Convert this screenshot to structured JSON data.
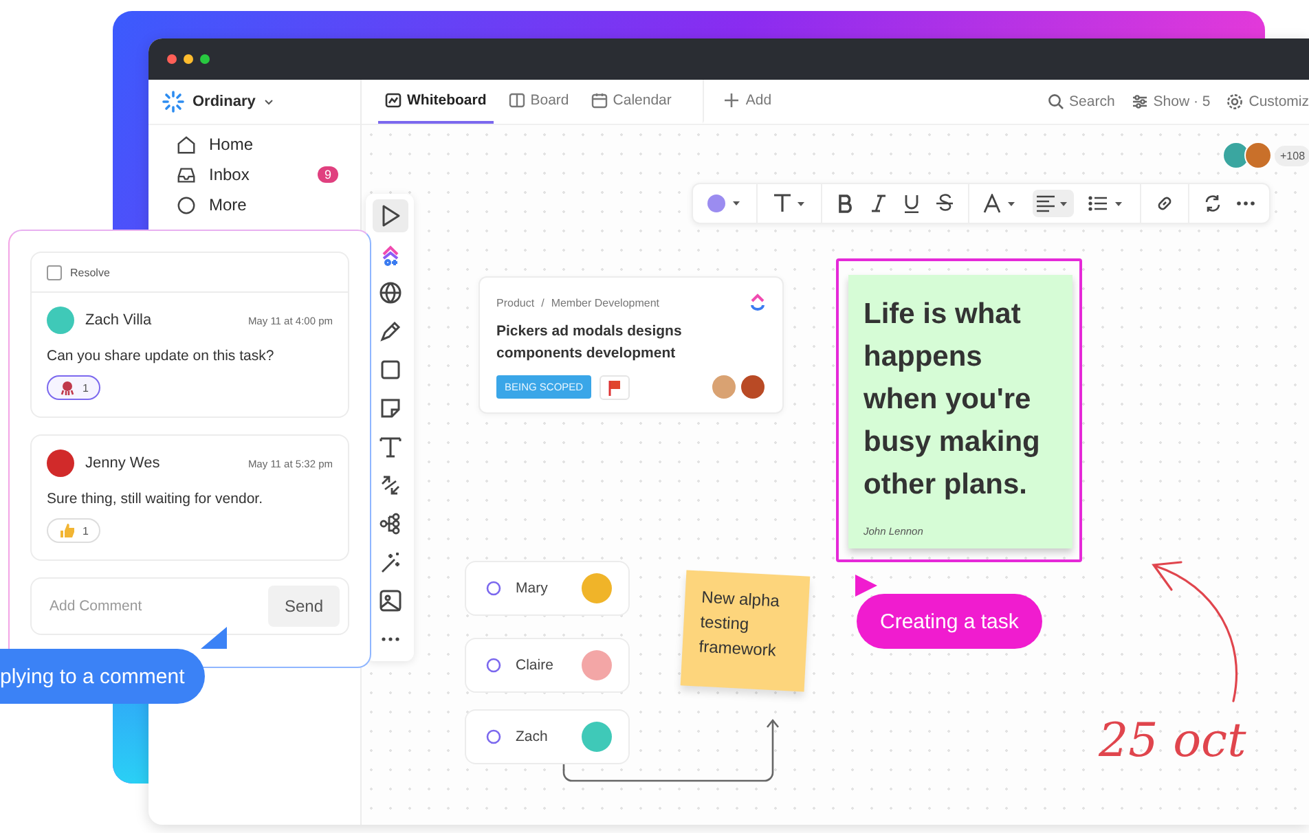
{
  "sidebar": {
    "workspace": "Ordinary",
    "items": [
      {
        "kind": "home",
        "label": "Home"
      },
      {
        "kind": "inbox",
        "label": "Inbox",
        "badge": "9"
      },
      {
        "kind": "more",
        "label": "More"
      }
    ]
  },
  "view_tabs": [
    {
      "kind": "whiteboard",
      "label": "Whiteboard",
      "selected": true
    },
    {
      "kind": "board",
      "label": "Board",
      "selected": false
    },
    {
      "kind": "calendar",
      "label": "Calendar",
      "selected": false
    },
    {
      "kind": "add",
      "label": "Add",
      "selected": false
    }
  ],
  "header_actions": [
    {
      "kind": "search",
      "label": "Search"
    },
    {
      "kind": "show",
      "label": "Show · 5"
    },
    {
      "kind": "settings",
      "label": "Customiz"
    }
  ],
  "collaborators": {
    "more": "+108"
  },
  "tool_rail": [
    {
      "kind": "pointer",
      "selected": true
    },
    {
      "kind": "ai",
      "selected": false
    },
    {
      "kind": "globe",
      "selected": false
    },
    {
      "kind": "pen",
      "selected": false
    },
    {
      "kind": "square",
      "selected": false
    },
    {
      "kind": "note",
      "selected": false
    },
    {
      "kind": "text",
      "selected": false
    },
    {
      "kind": "connector",
      "selected": false
    },
    {
      "kind": "mindmap",
      "selected": false
    },
    {
      "kind": "magic",
      "selected": false
    },
    {
      "kind": "image",
      "selected": false
    },
    {
      "kind": "more",
      "selected": false
    }
  ],
  "task_card": {
    "breadcrumb": [
      "Product",
      "Member Development"
    ],
    "breadcrumb_separator": "/",
    "title": "Pickers ad modals designs components development",
    "status": "BEING SCOPED"
  },
  "quote_note": {
    "text": "Life is what happens when you're busy making other plans.",
    "author": "John Lennon"
  },
  "people": [
    {
      "name": "Mary"
    },
    {
      "name": "Claire"
    },
    {
      "name": "Zach"
    }
  ],
  "sticky_note": {
    "text": "New alpha testing framework"
  },
  "cursor_label": "Creating a task",
  "annotation": "25 oct",
  "comments": {
    "resolve": {
      "label": "Resolve",
      "checked": false
    },
    "items": [
      {
        "author": "Zach Villa",
        "time": "May 11 at 4:00 pm",
        "text": "Can you share update on this task?",
        "reaction": {
          "kind": "octopus",
          "count": "1",
          "selected": true
        }
      },
      {
        "author": "Jenny Wes",
        "time": "May 11 at 5:32 pm",
        "text": "Sure thing, still waiting for vendor.",
        "reaction": {
          "kind": "thumbs",
          "count": "1",
          "selected": false
        }
      }
    ],
    "input": {
      "placeholder": "Add Comment"
    },
    "send": "Send"
  },
  "reply_label": "plying to a comment"
}
